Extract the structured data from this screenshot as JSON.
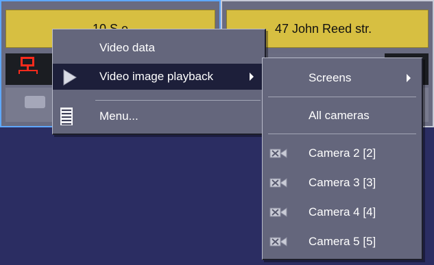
{
  "panels": {
    "left": {
      "address": "10 S                    e"
    },
    "right": {
      "address": "47 John Reed str."
    }
  },
  "context_menu": {
    "items": [
      {
        "label": "Video data"
      },
      {
        "label": "Video image playback"
      },
      {
        "label": "Menu..."
      }
    ]
  },
  "submenu": {
    "items": [
      {
        "label": "Screens"
      },
      {
        "label": "All cameras"
      },
      {
        "label": "Camera 2 [2]"
      },
      {
        "label": "Camera 3 [3]"
      },
      {
        "label": "Camera 4 [4]"
      },
      {
        "label": "Camera 5 [5]"
      }
    ]
  },
  "colors": {
    "background": "#2b2d62",
    "panel": "#696b81",
    "address_bar": "#d7bf41",
    "menu": "#64667c",
    "highlight": "#1d1f3a",
    "selected_border": "#5fa8ff"
  },
  "icons": {
    "network": "network-icon",
    "play": "play-arrow-icon",
    "menu": "document-list-icon",
    "camera": "camera-crossed-icon"
  }
}
